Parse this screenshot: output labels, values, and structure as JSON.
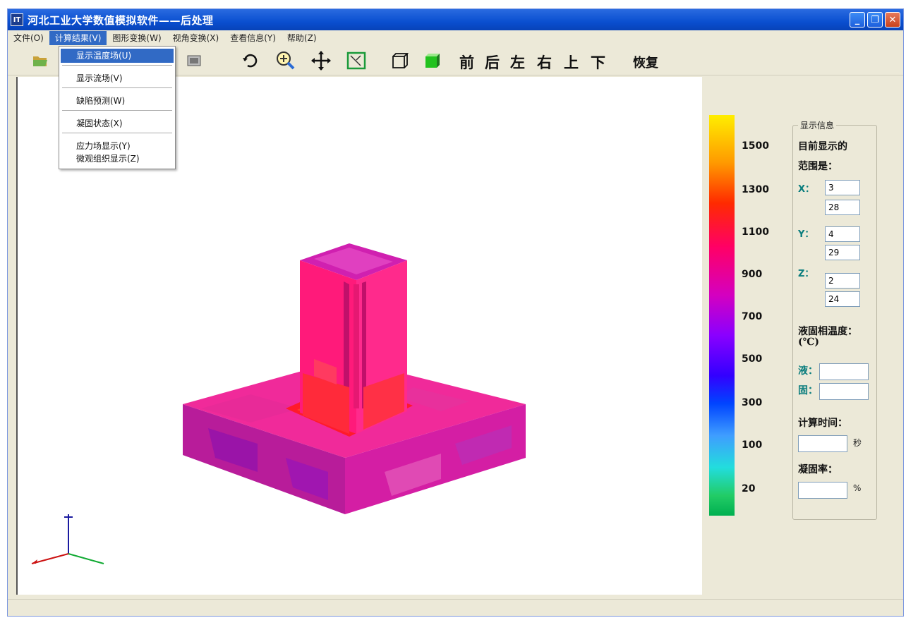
{
  "window": {
    "title": "河北工业大学数值模拟软件——后处理",
    "icon_text": "IT"
  },
  "menubar": [
    {
      "label": "文件(O)"
    },
    {
      "label": "计算结果(V)"
    },
    {
      "label": "图形变换(W)"
    },
    {
      "label": "视角变换(X)"
    },
    {
      "label": "查看信息(Y)"
    },
    {
      "label": "帮助(Z)"
    }
  ],
  "dropdown": [
    {
      "label": "显示温度场(U)"
    },
    {
      "label": "显示流场(V)"
    },
    {
      "label": "缺陷预测(W)"
    },
    {
      "label": "凝固状态(X)"
    },
    {
      "label": "应力场显示(Y)"
    },
    {
      "label": "微观组织显示(Z)"
    }
  ],
  "toolbar": {
    "icons": [
      "open-folder-icon",
      "screenshot-icon",
      "rotate-icon",
      "zoom-icon",
      "pan-icon",
      "select-box-icon",
      "wireframe-cube-icon",
      "solid-cube-icon"
    ],
    "views": [
      "前",
      "后",
      "左",
      "右",
      "上",
      "下"
    ],
    "restore_label": "恢复"
  },
  "legend": {
    "labels": [
      "1500",
      "1300",
      "1100",
      "900",
      "700",
      "500",
      "300",
      "100",
      "20"
    ]
  },
  "info": {
    "group_title": "显示信息",
    "range_line1": "目前显示的",
    "range_line2": "范围是：",
    "x_label": "X：",
    "x_min": "3",
    "x_max": "28",
    "y_label": "Y：",
    "y_min": "4",
    "y_max": "29",
    "z_label": "Z：",
    "z_min": "2",
    "z_max": "24",
    "temp_title_1": "液固相温度：",
    "temp_title_2": "(℃)",
    "liquid_label": "液：",
    "liquid_value": "",
    "solid_label": "固：",
    "solid_value": "",
    "time_title": "计算时间：",
    "time_value": "",
    "time_unit": "秒",
    "rate_title": "凝固率：",
    "rate_value": "",
    "rate_unit": "%"
  },
  "colors": {
    "title_blue": "#0a4fd0",
    "menu_highlight": "#316ac5",
    "part_magenta": "#e0198c",
    "hot_red": "#ff2a00",
    "hot_yellow": "#ffd000"
  }
}
